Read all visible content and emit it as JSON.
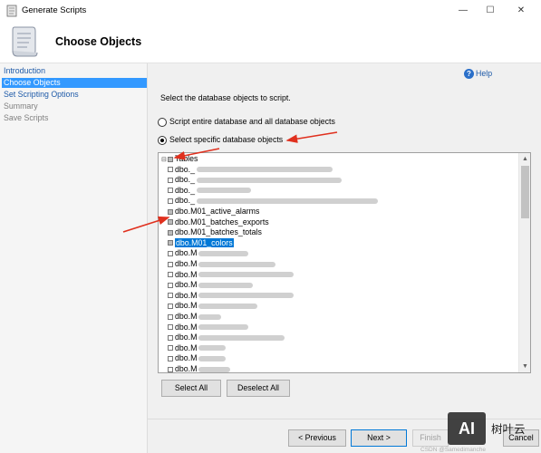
{
  "window": {
    "title": "Generate Scripts",
    "minimize_glyph": "—",
    "maximize_glyph": "☐",
    "close_glyph": "✕"
  },
  "header": {
    "title": "Choose Objects"
  },
  "sidebar": {
    "items": [
      {
        "label": "Introduction",
        "state": "link"
      },
      {
        "label": "Choose Objects",
        "state": "active"
      },
      {
        "label": "Set Scripting Options",
        "state": "link"
      },
      {
        "label": "Summary",
        "state": "disabled"
      },
      {
        "label": "Save Scripts",
        "state": "disabled"
      }
    ]
  },
  "main": {
    "help_label": "Help",
    "instruction": "Select the database objects to script.",
    "radio_entire": "Script entire database and all database objects",
    "radio_specific": "Select specific database objects",
    "selected_radio": "specific"
  },
  "tree": {
    "expander": "⊟",
    "root_label": "Tables",
    "nodes": [
      {
        "label": "dbo._",
        "checked": false,
        "selected": false
      },
      {
        "label": "dbo._",
        "checked": false,
        "selected": false
      },
      {
        "label": "dbo._",
        "checked": false,
        "selected": false
      },
      {
        "label": "dbo._",
        "checked": false,
        "selected": false
      },
      {
        "label": "dbo.M01_active_alarms",
        "checked": true,
        "selected": false
      },
      {
        "label": "dbo.M01_batches_exports",
        "checked": true,
        "selected": false
      },
      {
        "label": "dbo.M01_batches_totals",
        "checked": true,
        "selected": false
      },
      {
        "label": "dbo.M01_colors",
        "checked": true,
        "selected": true
      },
      {
        "label": "dbo.M",
        "checked": false,
        "selected": false
      },
      {
        "label": "dbo.M",
        "checked": false,
        "selected": false
      },
      {
        "label": "dbo.M",
        "checked": false,
        "selected": false
      },
      {
        "label": "dbo.M",
        "checked": false,
        "selected": false
      },
      {
        "label": "dbo.M",
        "checked": false,
        "selected": false
      },
      {
        "label": "dbo.M",
        "checked": false,
        "selected": false
      },
      {
        "label": "dbo.M",
        "checked": false,
        "selected": false
      },
      {
        "label": "dbo.M",
        "checked": false,
        "selected": false
      },
      {
        "label": "dbo.M",
        "checked": false,
        "selected": false
      },
      {
        "label": "dbo.M",
        "checked": false,
        "selected": false
      },
      {
        "label": "dbo.M",
        "checked": false,
        "selected": false
      },
      {
        "label": "dbo.M",
        "checked": false,
        "selected": false
      },
      {
        "label": "dbo.M",
        "checked": false,
        "selected": false
      }
    ],
    "scroll_up_glyph": "▲",
    "scroll_down_glyph": "▼"
  },
  "buttons": {
    "select_all": "Select All",
    "deselect_all": "Deselect All",
    "previous": "< Previous",
    "next": "Next >",
    "finish": "Finish",
    "cancel": "Cancel"
  },
  "watermark": {
    "logo": "AI",
    "text": "树叶云",
    "sub": "CSDN @Samedimanche"
  },
  "colors": {
    "accent": "#3399ff",
    "selection": "#0078d7",
    "annotation_arrow": "#e0301e",
    "link": "#1e5aa8"
  }
}
